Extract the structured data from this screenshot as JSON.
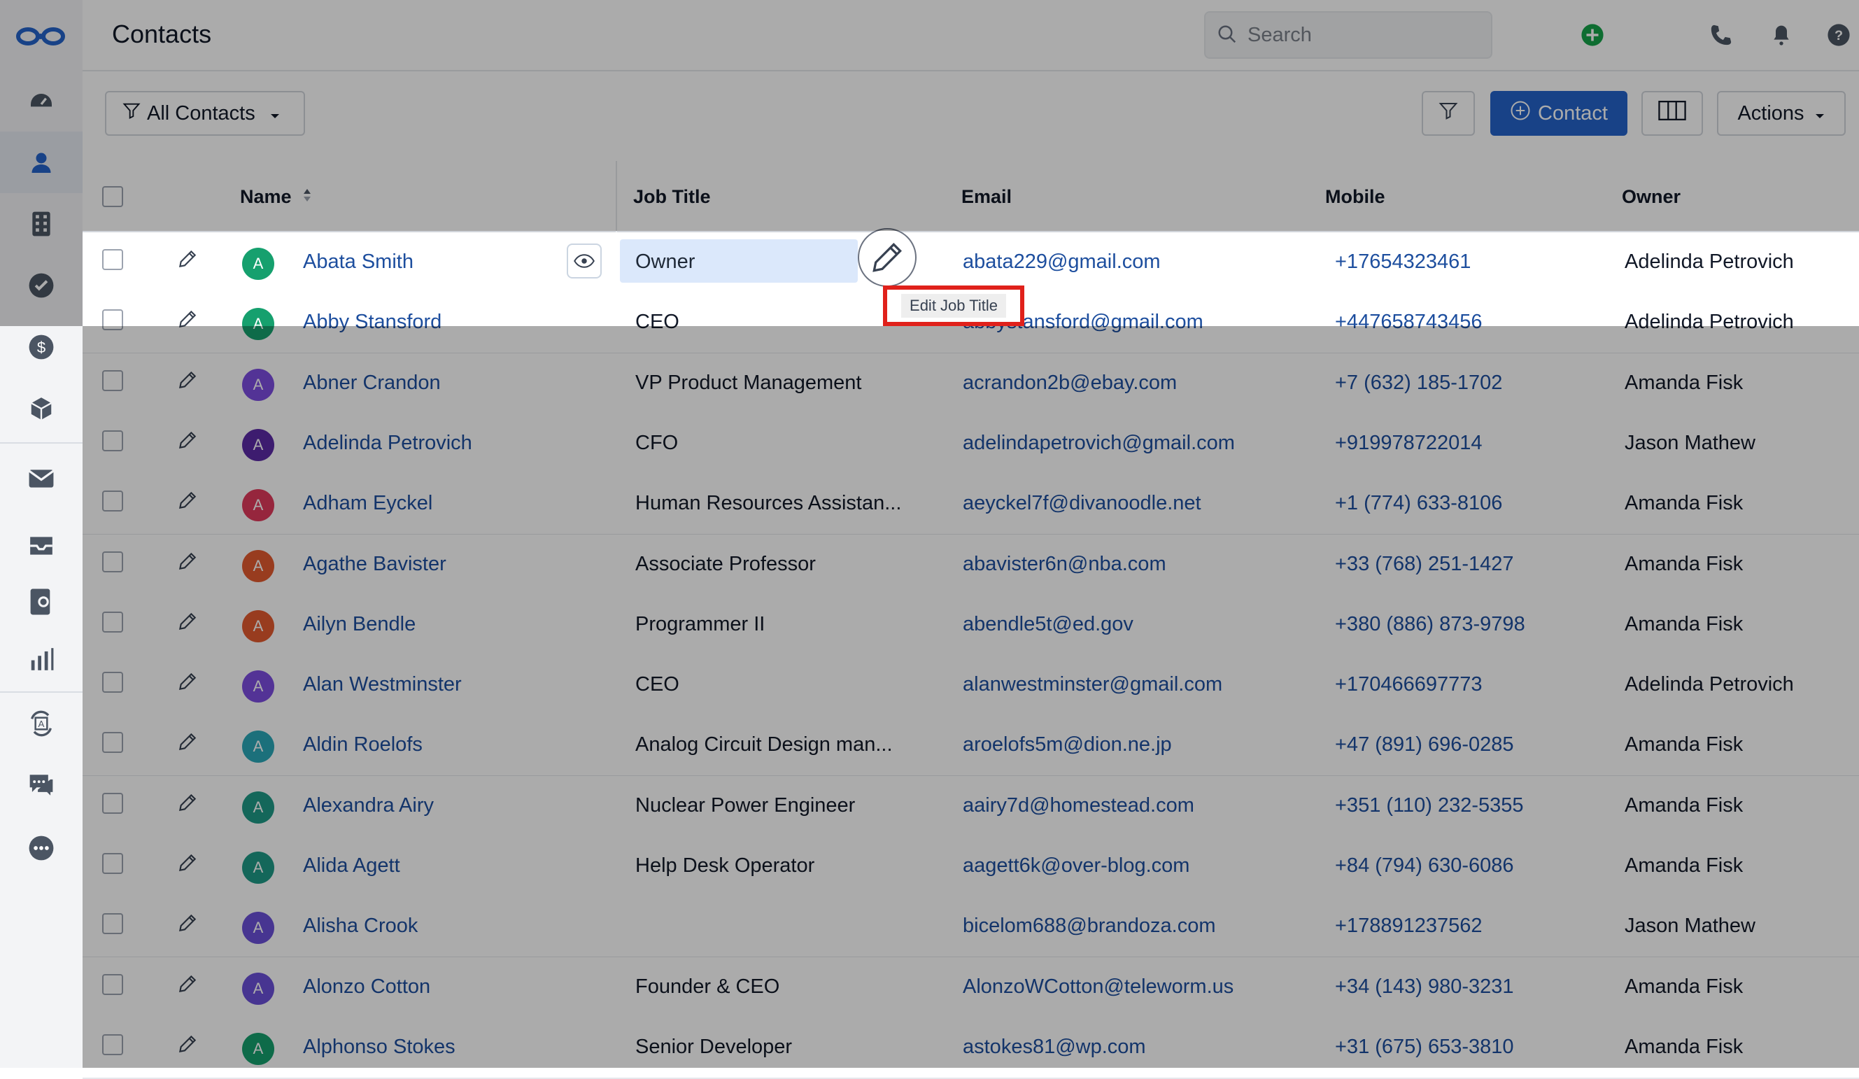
{
  "header": {
    "title": "Contacts",
    "search_placeholder": "Search"
  },
  "toolbar": {
    "view_label": "All Contacts",
    "contact_button": "Contact",
    "actions_button": "Actions"
  },
  "table": {
    "columns": [
      "Name",
      "Job Title",
      "Email",
      "Mobile",
      "Owner"
    ],
    "rows": [
      {
        "initial": "A",
        "avatar_color": "#16a06e",
        "name": "Abata Smith",
        "job": "Owner",
        "email": "abata229@gmail.com",
        "mobile": "+17654323461",
        "owner": "Adelinda Petrovich"
      },
      {
        "initial": "A",
        "avatar_color": "#16a06e",
        "name": "Abby Stansford",
        "job": "CEO",
        "email": "abbystansford@gmail.com",
        "mobile": "+447658743456",
        "owner": "Adelinda Petrovich"
      },
      {
        "initial": "A",
        "avatar_color": "#7c4ce0",
        "name": "Abner Crandon",
        "job": "VP Product Management",
        "email": "acrandon2b@ebay.com",
        "mobile": "+7 (632) 185-1702",
        "owner": "Amanda Fisk"
      },
      {
        "initial": "A",
        "avatar_color": "#5b2aa6",
        "name": "Adelinda Petrovich",
        "job": "CFO",
        "email": "adelindapetrovich@gmail.com",
        "mobile": "+919978722014",
        "owner": "Jason Mathew"
      },
      {
        "initial": "A",
        "avatar_color": "#e03a5c",
        "name": "Adham Eyckel",
        "job": "Human Resources Assistan...",
        "email": "aeyckel7f@divanoodle.net",
        "mobile": "+1 (774) 633-8106",
        "owner": "Amanda Fisk"
      },
      {
        "initial": "A",
        "avatar_color": "#e35a2f",
        "name": "Agathe Bavister",
        "job": "Associate Professor",
        "email": "abavister6n@nba.com",
        "mobile": "+33 (768) 251-1427",
        "owner": "Amanda Fisk"
      },
      {
        "initial": "A",
        "avatar_color": "#e35a2f",
        "name": "Ailyn Bendle",
        "job": "Programmer II",
        "email": "abendle5t@ed.gov",
        "mobile": "+380 (886) 873-9798",
        "owner": "Amanda Fisk"
      },
      {
        "initial": "A",
        "avatar_color": "#7c4ce0",
        "name": "Alan Westminster",
        "job": "CEO",
        "email": "alanwestminster@gmail.com",
        "mobile": "+170466697773",
        "owner": "Adelinda Petrovich"
      },
      {
        "initial": "A",
        "avatar_color": "#2aa7b8",
        "name": "Aldin Roelofs",
        "job": "Analog Circuit Design man...",
        "email": "aroelofs5m@dion.ne.jp",
        "mobile": "+47 (891) 696-0285",
        "owner": "Amanda Fisk"
      },
      {
        "initial": "A",
        "avatar_color": "#1f9a86",
        "name": "Alexandra Airy",
        "job": "Nuclear Power Engineer",
        "email": "aairy7d@homestead.com",
        "mobile": "+351 (110) 232-5355",
        "owner": "Amanda Fisk"
      },
      {
        "initial": "A",
        "avatar_color": "#1f9a86",
        "name": "Alida Agett",
        "job": "Help Desk Operator",
        "email": "aagett6k@over-blog.com",
        "mobile": "+84 (794) 630-6086",
        "owner": "Amanda Fisk"
      },
      {
        "initial": "A",
        "avatar_color": "#6a4fd8",
        "name": "Alisha Crook",
        "job": "",
        "email": "bicelom688@brandoza.com",
        "mobile": "+178891237562",
        "owner": "Jason Mathew"
      },
      {
        "initial": "A",
        "avatar_color": "#6a4fd8",
        "name": "Alonzo Cotton",
        "job": "Founder & CEO",
        "email": "AlonzoWCotton@teleworm.us",
        "mobile": "+34 (143) 980-3231",
        "owner": "Amanda Fisk"
      },
      {
        "initial": "A",
        "avatar_color": "#16a06e",
        "name": "Alphonso Stokes",
        "job": "Senior Developer",
        "email": "astokes81@wp.com",
        "mobile": "+31 (675) 653-3810",
        "owner": "Amanda Fisk"
      }
    ]
  },
  "tooltip": {
    "text": "Edit Job Title"
  },
  "colors": {
    "accent": "#2563c9",
    "highlight_box": "#e0211b",
    "add_green": "#16a34a"
  }
}
